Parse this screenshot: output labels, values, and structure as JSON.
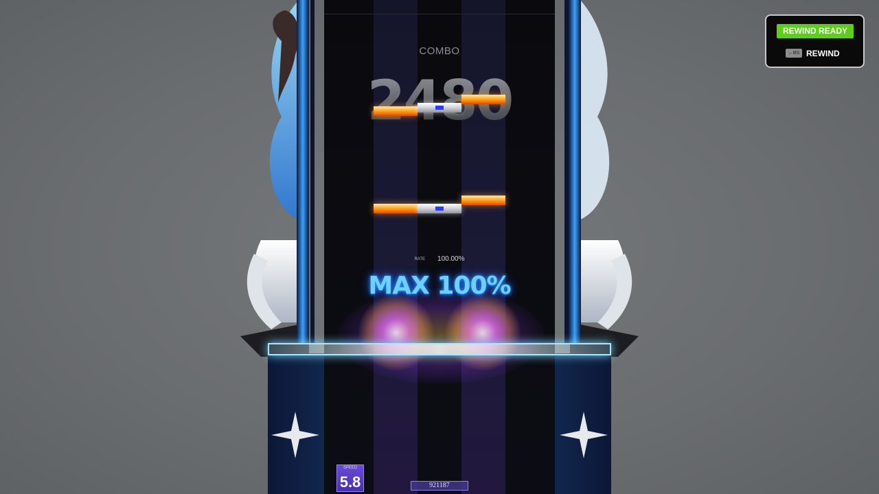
{
  "hud": {
    "combo_label": "COMBO",
    "combo_value": "2480",
    "rate_label": "RATE",
    "rate_value": "100.00%",
    "judgement": "MAX 100%",
    "speed_label": "SPEED",
    "speed_value": "5.8",
    "score": "921187"
  },
  "rewind": {
    "ready_label": "REWIND READY",
    "key": "←BS",
    "action_label": "REWIND"
  },
  "colors": {
    "background": "#6e7173",
    "rewind_ready": "#5ccf1a",
    "judgement_text": "#6fd0ff",
    "note_orange": "#ff8a14",
    "frame_blue": "#3aa0ff"
  },
  "icons": [
    "backspace-key-icon",
    "sparkle-icon",
    "feather-wing-icon"
  ]
}
